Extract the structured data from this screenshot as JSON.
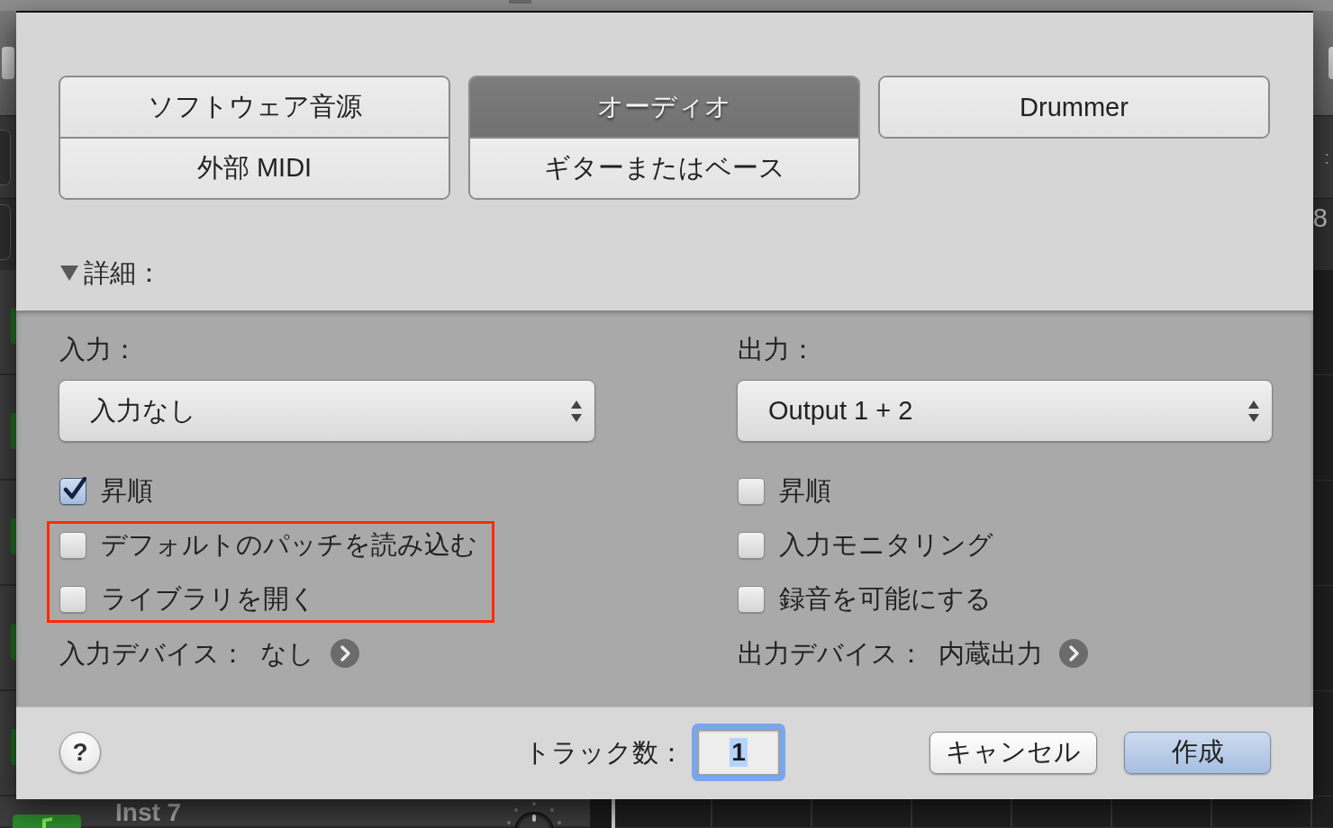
{
  "background": {
    "lcd_fragment": ":",
    "bar_number": "8",
    "track_name": "Inst 7"
  },
  "track_type_groups": [
    {
      "options": [
        {
          "label": "ソフトウェア音源",
          "selected": false
        },
        {
          "label": "外部 MIDI",
          "selected": false
        }
      ]
    },
    {
      "options": [
        {
          "label": "オーディオ",
          "selected": true
        },
        {
          "label": "ギターまたはベース",
          "selected": false
        }
      ]
    },
    {
      "options": [
        {
          "label": "Drummer",
          "selected": false
        }
      ]
    }
  ],
  "details": {
    "label": "詳細：",
    "expanded": true
  },
  "input": {
    "label": "入力：",
    "popup": "入力なし",
    "options": [
      {
        "label": "昇順",
        "checked": true,
        "highlighted": false
      },
      {
        "label": "デフォルトのパッチを読み込む",
        "checked": false,
        "highlighted": true
      },
      {
        "label": "ライブラリを開く",
        "checked": false,
        "highlighted": true
      }
    ],
    "device_label": "入力デバイス：",
    "device": "なし"
  },
  "output": {
    "label": "出力：",
    "popup": "Output 1 + 2",
    "options": [
      {
        "label": "昇順",
        "checked": false,
        "highlighted": false
      },
      {
        "label": "入力モニタリング",
        "checked": false,
        "highlighted": false
      },
      {
        "label": "録音を可能にする",
        "checked": false,
        "highlighted": false
      }
    ],
    "device_label": "出力デバイス：",
    "device": "内蔵出力"
  },
  "footer": {
    "help": "?",
    "track_count_label": "トラック数：",
    "track_count": "1",
    "track_count_focused": true,
    "track_count_text_selected": true,
    "buttons": [
      {
        "label": "キャンセル",
        "kind": "normal"
      },
      {
        "label": "作成",
        "kind": "default"
      }
    ]
  }
}
